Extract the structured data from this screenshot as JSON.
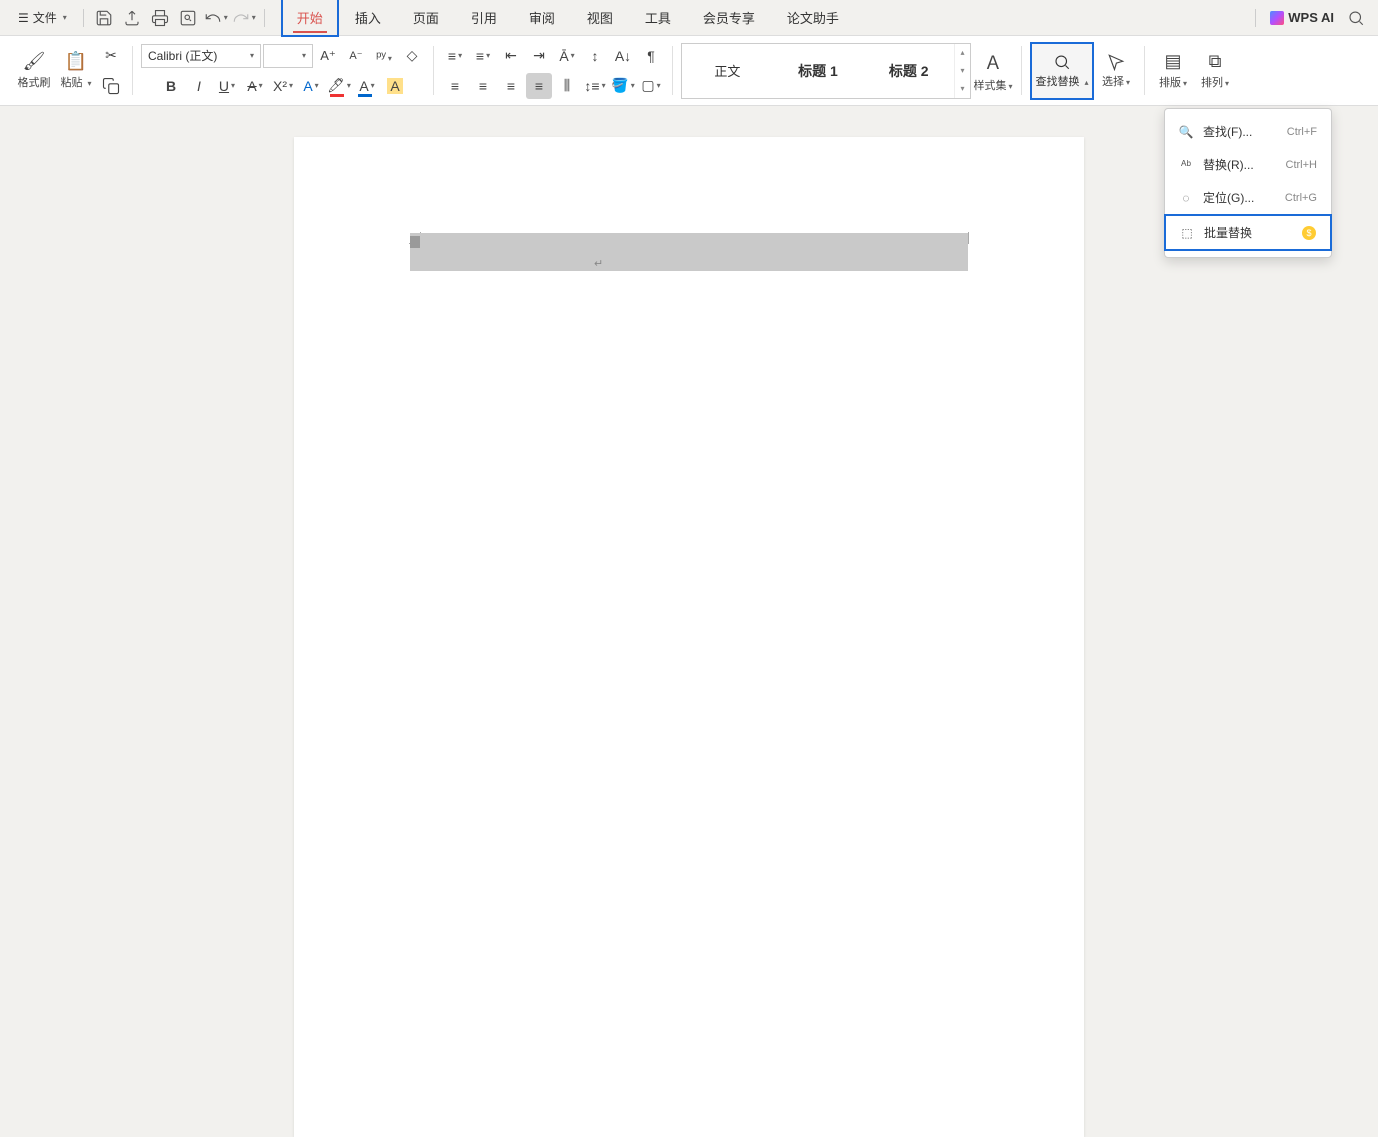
{
  "file_menu": "文件",
  "tabs": [
    "开始",
    "插入",
    "页面",
    "引用",
    "审阅",
    "视图",
    "工具",
    "会员专享",
    "论文助手"
  ],
  "active_tab_index": 0,
  "wps_ai": "WPS AI",
  "ribbon": {
    "format_painter": "格式刷",
    "paste": "粘贴",
    "font_name": "Calibri (正文)",
    "font_size": "",
    "styles": {
      "body": "正文",
      "h1": "标题 1",
      "h2": "标题 2"
    },
    "style_set": "样式集",
    "find_replace": "查找替换",
    "select": "选择",
    "layout": "排版",
    "arrange": "排列"
  },
  "find_menu": {
    "items": [
      {
        "icon": "search",
        "label": "查找(F)...",
        "shortcut": "Ctrl+F"
      },
      {
        "icon": "replace",
        "label": "替换(R)...",
        "shortcut": "Ctrl+H"
      },
      {
        "icon": "goto",
        "label": "定位(G)...",
        "shortcut": "Ctrl+G"
      },
      {
        "icon": "batch",
        "label": "批量替换",
        "shortcut": "",
        "premium": true
      }
    ],
    "highlighted_index": 3
  }
}
